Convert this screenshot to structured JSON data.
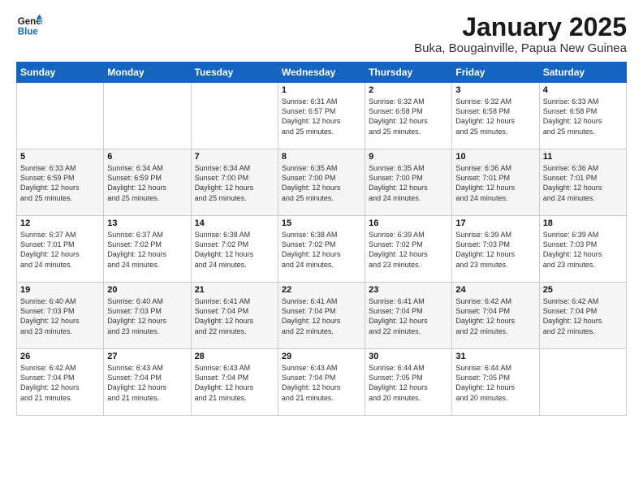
{
  "logo": {
    "line1": "General",
    "line2": "Blue"
  },
  "title": "January 2025",
  "subtitle": "Buka, Bougainville, Papua New Guinea",
  "days_of_week": [
    "Sunday",
    "Monday",
    "Tuesday",
    "Wednesday",
    "Thursday",
    "Friday",
    "Saturday"
  ],
  "weeks": [
    [
      {
        "num": "",
        "info": ""
      },
      {
        "num": "",
        "info": ""
      },
      {
        "num": "",
        "info": ""
      },
      {
        "num": "1",
        "info": "Sunrise: 6:31 AM\nSunset: 6:57 PM\nDaylight: 12 hours\nand 25 minutes."
      },
      {
        "num": "2",
        "info": "Sunrise: 6:32 AM\nSunset: 6:58 PM\nDaylight: 12 hours\nand 25 minutes."
      },
      {
        "num": "3",
        "info": "Sunrise: 6:32 AM\nSunset: 6:58 PM\nDaylight: 12 hours\nand 25 minutes."
      },
      {
        "num": "4",
        "info": "Sunrise: 6:33 AM\nSunset: 6:58 PM\nDaylight: 12 hours\nand 25 minutes."
      }
    ],
    [
      {
        "num": "5",
        "info": "Sunrise: 6:33 AM\nSunset: 6:59 PM\nDaylight: 12 hours\nand 25 minutes."
      },
      {
        "num": "6",
        "info": "Sunrise: 6:34 AM\nSunset: 6:59 PM\nDaylight: 12 hours\nand 25 minutes."
      },
      {
        "num": "7",
        "info": "Sunrise: 6:34 AM\nSunset: 7:00 PM\nDaylight: 12 hours\nand 25 minutes."
      },
      {
        "num": "8",
        "info": "Sunrise: 6:35 AM\nSunset: 7:00 PM\nDaylight: 12 hours\nand 25 minutes."
      },
      {
        "num": "9",
        "info": "Sunrise: 6:35 AM\nSunset: 7:00 PM\nDaylight: 12 hours\nand 24 minutes."
      },
      {
        "num": "10",
        "info": "Sunrise: 6:36 AM\nSunset: 7:01 PM\nDaylight: 12 hours\nand 24 minutes."
      },
      {
        "num": "11",
        "info": "Sunrise: 6:36 AM\nSunset: 7:01 PM\nDaylight: 12 hours\nand 24 minutes."
      }
    ],
    [
      {
        "num": "12",
        "info": "Sunrise: 6:37 AM\nSunset: 7:01 PM\nDaylight: 12 hours\nand 24 minutes."
      },
      {
        "num": "13",
        "info": "Sunrise: 6:37 AM\nSunset: 7:02 PM\nDaylight: 12 hours\nand 24 minutes."
      },
      {
        "num": "14",
        "info": "Sunrise: 6:38 AM\nSunset: 7:02 PM\nDaylight: 12 hours\nand 24 minutes."
      },
      {
        "num": "15",
        "info": "Sunrise: 6:38 AM\nSunset: 7:02 PM\nDaylight: 12 hours\nand 24 minutes."
      },
      {
        "num": "16",
        "info": "Sunrise: 6:39 AM\nSunset: 7:02 PM\nDaylight: 12 hours\nand 23 minutes."
      },
      {
        "num": "17",
        "info": "Sunrise: 6:39 AM\nSunset: 7:03 PM\nDaylight: 12 hours\nand 23 minutes."
      },
      {
        "num": "18",
        "info": "Sunrise: 6:39 AM\nSunset: 7:03 PM\nDaylight: 12 hours\nand 23 minutes."
      }
    ],
    [
      {
        "num": "19",
        "info": "Sunrise: 6:40 AM\nSunset: 7:03 PM\nDaylight: 12 hours\nand 23 minutes."
      },
      {
        "num": "20",
        "info": "Sunrise: 6:40 AM\nSunset: 7:03 PM\nDaylight: 12 hours\nand 23 minutes."
      },
      {
        "num": "21",
        "info": "Sunrise: 6:41 AM\nSunset: 7:04 PM\nDaylight: 12 hours\nand 22 minutes."
      },
      {
        "num": "22",
        "info": "Sunrise: 6:41 AM\nSunset: 7:04 PM\nDaylight: 12 hours\nand 22 minutes."
      },
      {
        "num": "23",
        "info": "Sunrise: 6:41 AM\nSunset: 7:04 PM\nDaylight: 12 hours\nand 22 minutes."
      },
      {
        "num": "24",
        "info": "Sunrise: 6:42 AM\nSunset: 7:04 PM\nDaylight: 12 hours\nand 22 minutes."
      },
      {
        "num": "25",
        "info": "Sunrise: 6:42 AM\nSunset: 7:04 PM\nDaylight: 12 hours\nand 22 minutes."
      }
    ],
    [
      {
        "num": "26",
        "info": "Sunrise: 6:42 AM\nSunset: 7:04 PM\nDaylight: 12 hours\nand 21 minutes."
      },
      {
        "num": "27",
        "info": "Sunrise: 6:43 AM\nSunset: 7:04 PM\nDaylight: 12 hours\nand 21 minutes."
      },
      {
        "num": "28",
        "info": "Sunrise: 6:43 AM\nSunset: 7:04 PM\nDaylight: 12 hours\nand 21 minutes."
      },
      {
        "num": "29",
        "info": "Sunrise: 6:43 AM\nSunset: 7:04 PM\nDaylight: 12 hours\nand 21 minutes."
      },
      {
        "num": "30",
        "info": "Sunrise: 6:44 AM\nSunset: 7:05 PM\nDaylight: 12 hours\nand 20 minutes."
      },
      {
        "num": "31",
        "info": "Sunrise: 6:44 AM\nSunset: 7:05 PM\nDaylight: 12 hours\nand 20 minutes."
      },
      {
        "num": "",
        "info": ""
      }
    ]
  ]
}
